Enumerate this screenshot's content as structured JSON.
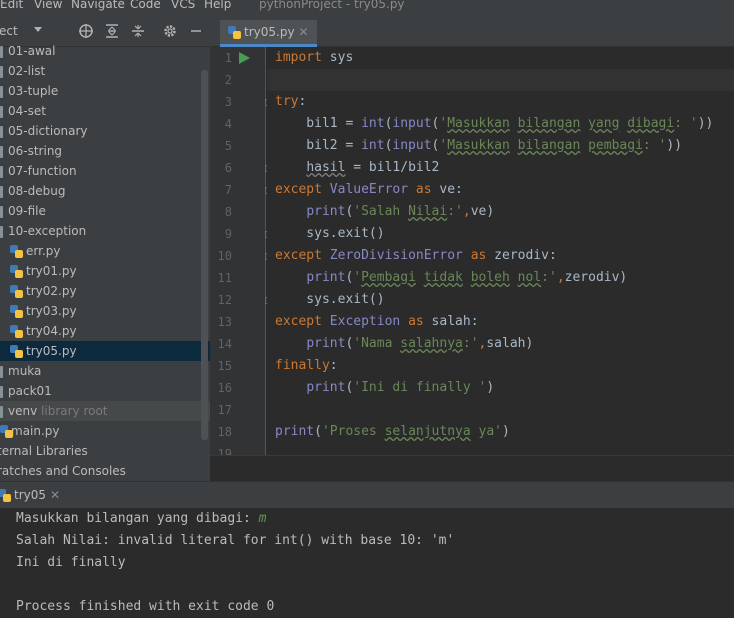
{
  "menubar": {
    "items": [
      "Edit",
      "View",
      "Navigate",
      "Code",
      "VCS",
      "Help"
    ],
    "window_title": "pythonProject - try05.py"
  },
  "project_panel": {
    "label": "ect",
    "tools": [
      "target-icon",
      "expand-all-icon",
      "collapse-all-icon",
      "gear-icon",
      "minimize-icon"
    ]
  },
  "tree": {
    "items": [
      {
        "label": "01-awal",
        "type": "folder"
      },
      {
        "label": "02-list",
        "type": "folder"
      },
      {
        "label": "03-tuple",
        "type": "folder"
      },
      {
        "label": "04-set",
        "type": "folder"
      },
      {
        "label": "05-dictionary",
        "type": "folder"
      },
      {
        "label": "06-string",
        "type": "folder"
      },
      {
        "label": "07-function",
        "type": "folder"
      },
      {
        "label": "08-debug",
        "type": "folder"
      },
      {
        "label": "09-file",
        "type": "folder"
      },
      {
        "label": "10-exception",
        "type": "folder"
      },
      {
        "label": "err.py",
        "type": "python"
      },
      {
        "label": "try01.py",
        "type": "python"
      },
      {
        "label": "try02.py",
        "type": "python"
      },
      {
        "label": "try03.py",
        "type": "python"
      },
      {
        "label": "try04.py",
        "type": "python"
      },
      {
        "label": "try05.py",
        "type": "python",
        "selected": true
      },
      {
        "label": "muka",
        "type": "folder"
      },
      {
        "label": "pack01",
        "type": "folder"
      },
      {
        "label": "venv",
        "type": "folder",
        "suffix": "library root"
      },
      {
        "label": "main.py",
        "type": "python"
      },
      {
        "label": "ternal Libraries",
        "type": "plain"
      },
      {
        "label": "ratches and Consoles",
        "type": "plain"
      }
    ]
  },
  "editor": {
    "tab_label": "try05.py",
    "line_numbers": [
      "1",
      "2",
      "3",
      "4",
      "5",
      "6",
      "7",
      "8",
      "9",
      "10",
      "11",
      "12",
      "13",
      "14",
      "15",
      "16",
      "17",
      "18",
      "19"
    ]
  },
  "run_panel": {
    "tab_label": "try05",
    "console": {
      "line1_prompt": "Masukkan bilangan yang dibagi: ",
      "line1_input": "m",
      "line2": "Salah Nilai: invalid literal for int() with base 10: 'm'",
      "line3": "Ini di finally",
      "line5": "Process finished with exit code 0"
    }
  },
  "colors": {
    "keyword": "#cc7832",
    "string": "#6a8759",
    "builtin": "#8888c6",
    "run_arrow": "#499c54",
    "selection": "#0d293e"
  }
}
